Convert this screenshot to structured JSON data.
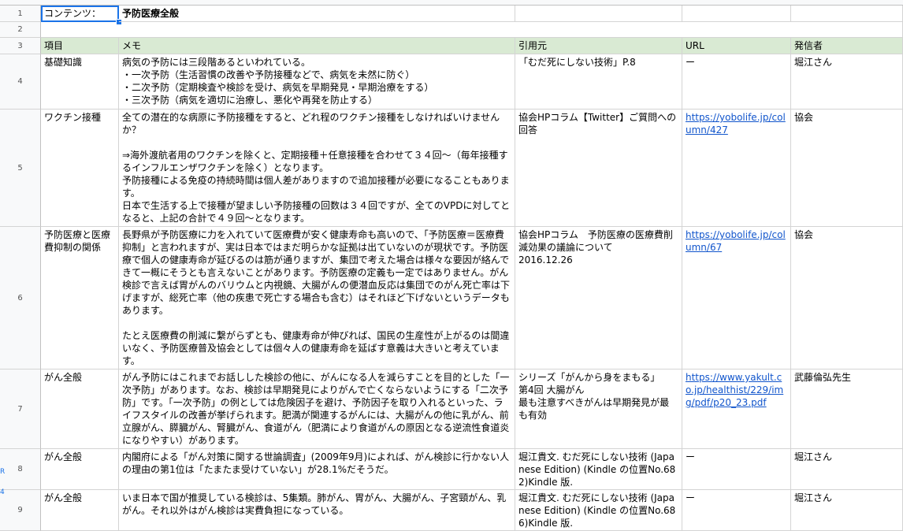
{
  "row_numbers": [
    "1",
    "2",
    "3",
    "4",
    "5",
    "6",
    "7",
    "8",
    "9"
  ],
  "content_label": "コンテンツ：",
  "content_value": "予防医療全般",
  "headers": {
    "item": "項目",
    "memo": "メモ",
    "source": "引用元",
    "url": "URL",
    "author": "発信者"
  },
  "rows": [
    {
      "item": "基礎知識",
      "memo": "病気の予防には三段階あるといわれている。\n・一次予防（生活習慣の改善や予防接種などで、病気を未然に防ぐ）\n・二次予防（定期検査や検診を受け、病気を早期発見・早期治療をする）\n・三次予防（病気を適切に治療し、悪化や再発を防止する）",
      "source": "「むだ死にしない技術」P.8",
      "url": "ー",
      "author": "堀江さん"
    },
    {
      "item": "ワクチン接種",
      "memo": "全ての潜在的な病原に予防接種をすると、どれ程のワクチン接種をしなければいけませんか？\n\n⇒海外渡航者用のワクチンを除くと、定期接種＋任意接種を合わせて３４回～（毎年接種するインフルエンザワクチンを除く）となります。\n予防接種による免疫の持続時間は個人差がありますので追加接種が必要になることもあります。\n日本で生活する上で接種が望ましい予防接種の回数は３４回ですが、全てのVPDに対してとなると、上記の合計で４９回～となります。",
      "source": "協会HPコラム【Twitter】ご質問への回答",
      "url": "https://yobolife.jp/column/427",
      "author": "協会"
    },
    {
      "item": "予防医療と医療費抑制の関係",
      "memo": "長野県が予防医療に力を入れていて医療費が安く健康寿命も高いので、「予防医療＝医療費抑制」と言われますが、実は日本ではまだ明らかな証拠は出ていないのが現状です。予防医療で個人の健康寿命が延びるのは筋が通りますが、集団で考えた場合は様々な要因が絡んできて一概にそうとも言えないことがあります。予防医療の定義も一定ではありません。がん検診で言えば胃がんのバリウムと内視鏡、大腸がんの便潜血反応は集団でのがん死亡率は下げますが、総死亡率（他の疾患で死亡する場合も含む）はそれほど下げないというデータもあります。\n\nたとえ医療費の削減に繋がらずとも、健康寿命が伸びれば、国民の生産性が上がるのは間違いなく、予防医療普及協会としては個々人の健康寿命を延ばす意義は大きいと考えています。",
      "source": "協会HPコラム　予防医療の医療費削減効果の議論について\n2016.12.26",
      "url": "https://yobolife.jp/column/67",
      "author": "協会"
    },
    {
      "item": "がん全般",
      "memo": "がん予防にはこれまでお話しした検診の他に、がんになる人を減らすことを目的とした「一次予防」があります。なお、検診は早期発見によりがんで亡くならないようにする「二次予防」です。「一次予防」の例としては危険因子を避け、予防因子を取り入れるといった、ライフスタイルの改善が挙げられます。肥満が関連するがんには、大腸がんの他に乳がん、前立腺がん、膵臓がん、腎臓がん、食道がん（肥満により食道がんの原因となる逆流性食道炎になりやすい）があります。",
      "source": "シリーズ「がんから身をまもる」\n第4回 大腸がん\n最も注意すべきがんは早期発見が最も有効",
      "url": "https://www.yakult.co.jp/healthist/229/img/pdf/p20_23.pdf",
      "author": "武藤倫弘先生"
    },
    {
      "item": "がん全般",
      "memo": "内閣府による「がん対策に関する世論調査」(2009年9月)によれば、がん検診に行かない人の理由の第1位は「たまたま受けていない」が28.1%だそうだ。",
      "source": "堀江貴文. むだ死にしない技術 (Japanese Edition) (Kindle の位置No.682)Kindle 版.",
      "url": "ー",
      "author": "堀江さん"
    },
    {
      "item": "がん全般",
      "memo": "いま日本で国が推奨している検診は、5集類。肺がん、胃がん、大腸がん、子宮頸がん、乳がん。それ以外はがん検診は実費負担になっている。",
      "source": "堀江貴文. むだ死にしない技術 (Japanese Edition) (Kindle の位置No.686)Kindle 版.",
      "url": "ー",
      "author": "堀江さん"
    }
  ],
  "edge_glyphs": [
    "R",
    "4"
  ]
}
